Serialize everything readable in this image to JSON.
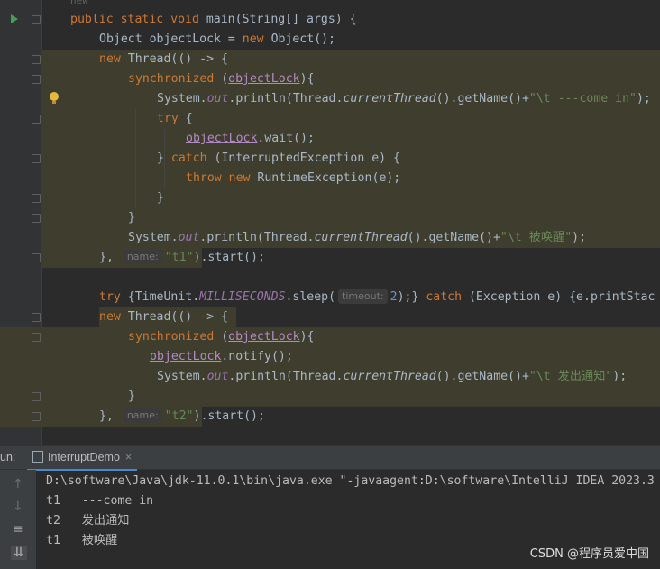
{
  "editor": {
    "top_fragment": "new",
    "lines": {
      "l1": {
        "kw": "public static void ",
        "name": "main(String[] args) {"
      },
      "l2": {
        "a": "Object objectLock = ",
        "kw": "new ",
        "b": "Object();"
      },
      "l3": {
        "kw": "new ",
        "b": "Thread(() -> {"
      },
      "l4": {
        "kw": "synchronized ",
        "a": "(",
        "lock": "objectLock",
        "b": "){"
      },
      "l5": {
        "a": "System.",
        "out": "out",
        "b": ".println(Thread.",
        "ct": "currentThread",
        "c": "().getName()+",
        "s": "\"\\t ---come in\"",
        "d": ");"
      },
      "l6": {
        "kw": "try ",
        "b": "{"
      },
      "l7": {
        "lock": "objectLock",
        "b": ".wait();"
      },
      "l8": {
        "a": "} ",
        "kw": "catch ",
        "b": "(InterruptedException e) {"
      },
      "l9": {
        "kw": "throw new ",
        "b": "RuntimeException(e);"
      },
      "l10": {
        "b": "}"
      },
      "l11": {
        "b": "}"
      },
      "l12": {
        "a": "System.",
        "out": "out",
        "b": ".println(Thread.",
        "ct": "currentThread",
        "c": "().getName()+",
        "s": "\"\\t 被唤醒\"",
        "d": ");"
      },
      "l13": {
        "a": "}, ",
        "hint": "name:",
        "s": "\"t1\"",
        "b": ").start();"
      },
      "l14": {
        "kw": "try ",
        "a": "{TimeUnit.",
        "fld": "MILLISECONDS",
        "b": ".sleep(",
        "hint": "timeout:",
        "num": "2",
        "c": ");} ",
        "kw2": "catch ",
        "d": "(Exception e) {e.printStac"
      },
      "l15": {
        "kw": "new ",
        "b": "Thread(() -> {"
      },
      "l16": {
        "kw": "synchronized ",
        "a": "(",
        "lock": "objectLock",
        "b": "){"
      },
      "l17": {
        "lock": "objectLock",
        "b": ".notify();"
      },
      "l18": {
        "a": "System.",
        "out": "out",
        "b": ".println(Thread.",
        "ct": "currentThread",
        "c": "().getName()+",
        "s": "\"\\t 发出通知\"",
        "d": ");"
      },
      "l19": {
        "b": "}"
      },
      "l20": {
        "a": "}, ",
        "hint": "name:",
        "s": "\"t2\"",
        "b": ").start();"
      }
    }
  },
  "run_panel": {
    "label": "un:",
    "tab_name": "InterruptDemo",
    "tab_close": "×",
    "console": [
      "D:\\software\\Java\\jdk-11.0.1\\bin\\java.exe \"-javaagent:D:\\software\\IntelliJ IDEA 2023.3",
      "t1   ---come in",
      "t2   发出通知",
      "t1   被唤醒"
    ]
  },
  "watermark": "CSDN @程序员爱中国",
  "colors": {
    "background": "#2b2b2b",
    "keyword": "#cc7832",
    "string": "#6a8759",
    "field": "#9876aa",
    "highlight": "#3f3e2e"
  }
}
